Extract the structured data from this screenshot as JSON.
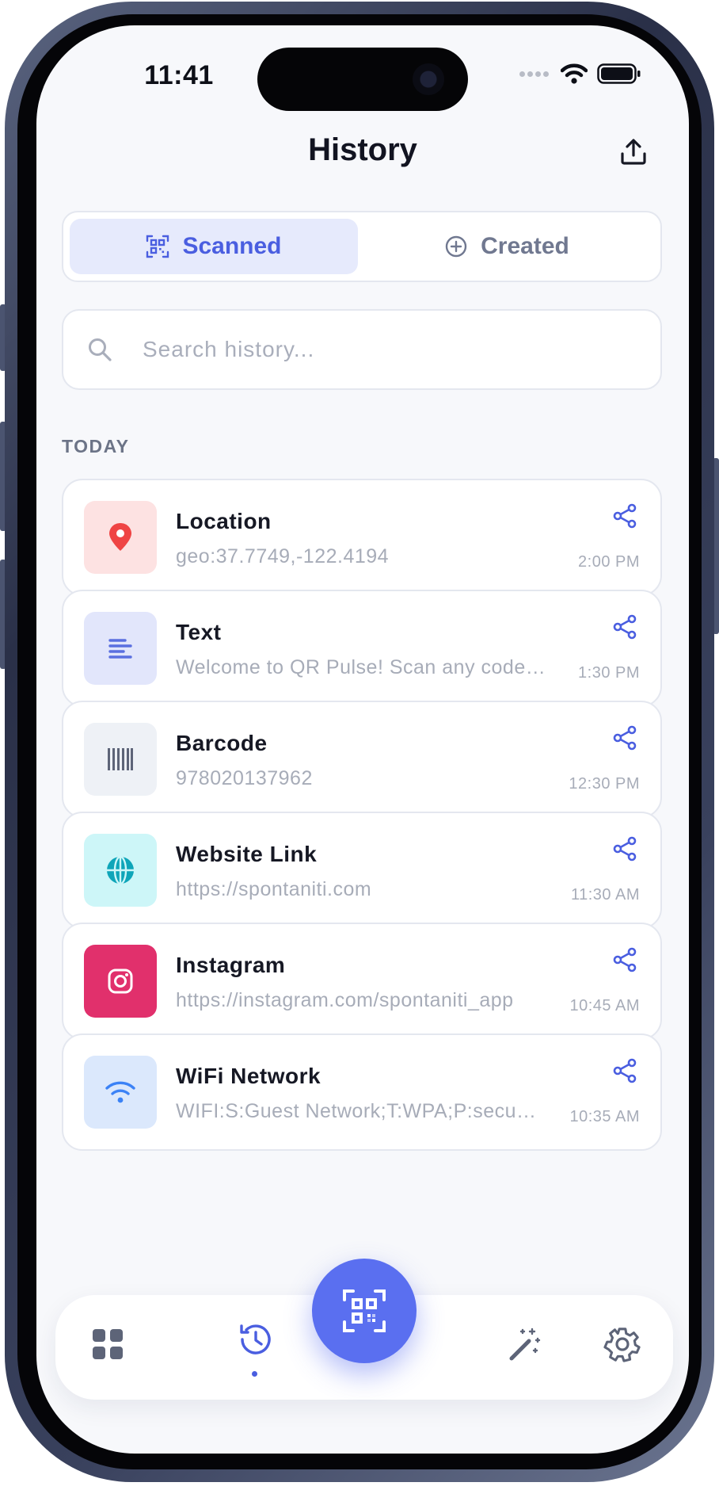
{
  "status_bar": {
    "time": "11:41"
  },
  "header": {
    "title": "History",
    "share_icon": "share-upload-icon"
  },
  "tabs": [
    {
      "label": "Scanned",
      "icon": "qr-scan-icon",
      "active": true
    },
    {
      "label": "Created",
      "icon": "plus-circle-icon",
      "active": false
    }
  ],
  "search": {
    "placeholder": "Search history...",
    "value": ""
  },
  "section": {
    "label": "TODAY"
  },
  "items": [
    {
      "title": "Location",
      "subtitle": "geo:37.7749,-122.4194",
      "time": "2:00 PM",
      "icon": "location-pin-icon",
      "icon_bg": "#fde2e2",
      "icon_color": "#ef4444"
    },
    {
      "title": "Text",
      "subtitle": "Welcome to QR Pulse! Scan any code to get started.",
      "time": "1:30 PM",
      "icon": "text-lines-icon",
      "icon_bg": "#e2e6fb",
      "icon_color": "#5a6fe0"
    },
    {
      "title": "Barcode",
      "subtitle": "978020137962",
      "time": "12:30 PM",
      "icon": "barcode-icon",
      "icon_bg": "#eef1f6",
      "icon_color": "#5d6478"
    },
    {
      "title": "Website Link",
      "subtitle": "https://spontaniti.com",
      "time": "11:30 AM",
      "icon": "globe-icon",
      "icon_bg": "#cdf6f8",
      "icon_color": "#0ea5b9"
    },
    {
      "title": "Instagram",
      "subtitle": "https://instagram.com/spontaniti_app",
      "time": "10:45 AM",
      "icon": "instagram-icon",
      "icon_bg": "#e1306c",
      "icon_color": "#ffffff"
    },
    {
      "title": "WiFi Network",
      "subtitle": "WIFI:S:Guest Network;T:WPA;P:securepass;;",
      "time": "10:35 AM",
      "icon": "wifi-icon",
      "icon_bg": "#dbe8fc",
      "icon_color": "#3b82f6"
    }
  ],
  "bottom_nav": {
    "items": [
      {
        "icon": "grid-icon",
        "active": false
      },
      {
        "icon": "history-icon",
        "active": true
      },
      {
        "icon": "magic-wand-icon",
        "active": false
      },
      {
        "icon": "gear-icon",
        "active": false
      }
    ],
    "fab_icon": "qr-scan-icon"
  },
  "colors": {
    "accent": "#4a5ee0",
    "fab": "#5a6ff0",
    "background": "#f7f8fb"
  }
}
